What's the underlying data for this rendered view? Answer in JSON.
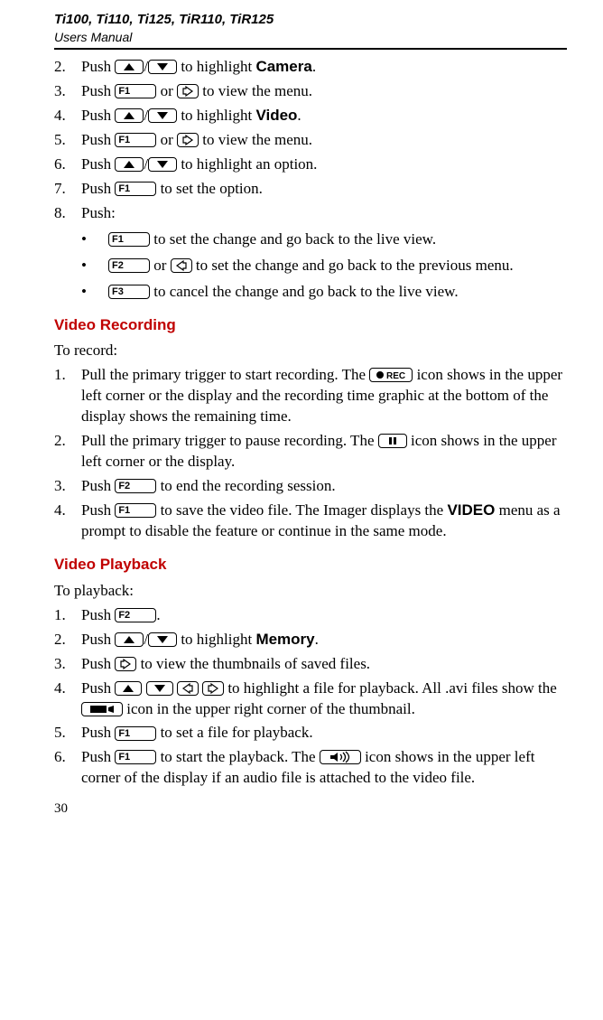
{
  "header": {
    "models": "Ti100, Ti110, Ti125, TiR110, TiR125",
    "subtitle": "Users Manual"
  },
  "keys": {
    "F1": "F1",
    "F2": "F2",
    "F3": "F3",
    "REC": "REC"
  },
  "steps_a": {
    "s2": {
      "n": "2.",
      "pre": "Push ",
      "post": " to highlight ",
      "target": "Camera",
      "end": "."
    },
    "s3": {
      "n": "3.",
      "pre": "Push ",
      "mid": " or ",
      "post": " to view the menu."
    },
    "s4": {
      "n": "4.",
      "pre": "Push ",
      "post": " to highlight ",
      "target": "Video",
      "end": "."
    },
    "s5": {
      "n": "5.",
      "pre": "Push ",
      "mid": " or ",
      "post": " to view the menu."
    },
    "s6": {
      "n": "6.",
      "pre": "Push ",
      "post": " to highlight an option."
    },
    "s7": {
      "n": "7.",
      "pre": "Push ",
      "post": " to set the option."
    },
    "s8": {
      "n": "8.",
      "text": "Push:"
    }
  },
  "bullets": {
    "b1": {
      "post": " to set the change and go back to the live view."
    },
    "b2": {
      "mid": " or ",
      "post": " to set the change and go back to the previous menu."
    },
    "b3": {
      "post": " to cancel the change and go back to the live view."
    }
  },
  "sec_rec": {
    "title": "Video Recording",
    "intro": "To record:",
    "s1": {
      "n": "1.",
      "pre": "Pull the primary trigger to start recording. The ",
      "post": " icon shows in the upper left corner or the display and the recording time graphic at the bottom of the display shows the remaining time."
    },
    "s2": {
      "n": "2.",
      "pre": "Pull the primary trigger to pause recording. The ",
      "post": " icon shows in the upper left corner or the display."
    },
    "s3": {
      "n": "3.",
      "pre": "Push ",
      "post": " to end the recording session."
    },
    "s4": {
      "n": "4.",
      "pre": "Push ",
      "mid": " to save the video file. The Imager displays the ",
      "target": "VIDEO",
      "post": " menu as a prompt to disable the feature or continue in the same mode."
    }
  },
  "sec_play": {
    "title": "Video Playback",
    "intro": "To playback:",
    "s1": {
      "n": "1.",
      "pre": "Push ",
      "end": "."
    },
    "s2": {
      "n": "2.",
      "pre": "Push ",
      "post": " to highlight ",
      "target": "Memory",
      "end": "."
    },
    "s3": {
      "n": "3.",
      "pre": "Push ",
      "post": " to view the thumbnails of saved files."
    },
    "s4": {
      "n": "4.",
      "pre": "Push ",
      "mid": " to highlight a file for playback. All .avi files show the ",
      "post": " icon in the upper right corner of the thumbnail."
    },
    "s5": {
      "n": "5.",
      "pre": "Push ",
      "post": " to set a file for playback."
    },
    "s6": {
      "n": "6.",
      "pre": "Push ",
      "mid": " to start the playback. The ",
      "post": " icon shows in the upper left corner of the display if an audio file is attached to the video file."
    }
  },
  "page_number": "30"
}
